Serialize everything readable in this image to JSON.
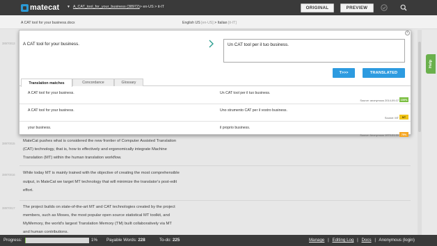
{
  "header": {
    "logo_text": "matecat",
    "project_name": "A_CAT_tool_for_your_business (38972)",
    "project_lang": " > en-US > it-IT",
    "original_label": "ORIGINAL",
    "preview_label": "PREVIEW"
  },
  "filebar": {
    "filename": "A CAT tool for your business.docx",
    "source_lang": "English US",
    "source_code": "[en-US]",
    "arrow": ">",
    "target_lang": "Italian",
    "target_code": "[it-IT]"
  },
  "editor": {
    "segment_id": "38970013",
    "source": "A CAT tool for your business.",
    "target": "Un CAT tool per il tuo business.",
    "t_button": "T>>>",
    "translated_button": "TRANSLATED",
    "close": "x"
  },
  "tabs": [
    "Translation matches",
    "Concordance",
    "Glossary"
  ],
  "matches": [
    {
      "source": "A CAT tool for your business.",
      "target": "Un CAT tool per il tuo business.",
      "meta": "Source: anonymous   2014-09-07",
      "badge": "100%",
      "badge_color": "#7cbf43"
    },
    {
      "source": "A CAT tool for your business.",
      "target": "Uno strumento CAT per il vostro business.",
      "meta": "Source: MT",
      "badge": "MT",
      "badge_color": "#f0c419"
    },
    {
      "source": "your business.",
      "target": "il proprio business.",
      "meta": "Source: Anonymous   1970-01-01",
      "badge": "75%",
      "badge_color": "#f5a623"
    }
  ],
  "segments": [
    {
      "id": "38970015",
      "lines": [
        "MateCat pushes what is considered the new frontier of Computer Assisted Translation",
        "(CAT) technology, that is, how to effectively and ergonomically integrate Machine",
        "Translation (MT) within the human translation workflow."
      ]
    },
    {
      "id": "38970016",
      "lines": [
        "While today MT is mainly trained with the objective of creating the most comprehensible",
        "output, in MateCat we target MT technology that will minimize the translator's post-edit",
        "effort."
      ]
    },
    {
      "id": "38970017",
      "lines": [
        "The project builds on state-of-the-art MT and CAT technologies created by the project",
        "members, such as Moses, the most popular open source statistical MT toolkit, and",
        "MyMemory, the world's largest Translation Memory (TM) built collaboratively via MT",
        "and human contributions."
      ]
    }
  ],
  "help_label": "Help",
  "footer": {
    "progress_label": "Progress:",
    "progress_value": 0.01,
    "percent": "1%",
    "payable_label": "Payable Words:",
    "payable_value": "228",
    "todo_label": "To-do:",
    "todo_value": "225",
    "links": [
      "Manage",
      "Editing Log",
      "Docs",
      "Anonymous (login)"
    ],
    "separator": "|"
  },
  "colors": {
    "accent": "#2d9be0",
    "header_bg": "#3a3a3a",
    "progress_fill": "#7fbf4d",
    "help": "#6ab04c"
  }
}
